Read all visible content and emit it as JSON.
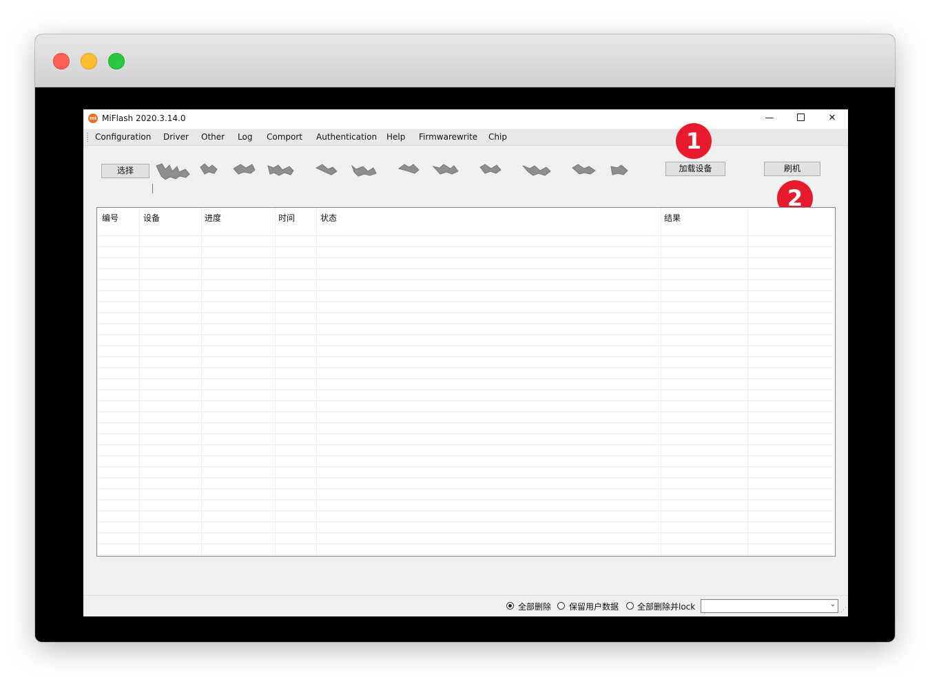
{
  "window": {
    "title": "MiFlash 2020.3.14.0",
    "app_icon_text": "mi",
    "minimize_glyph": "—",
    "close_glyph": "✕"
  },
  "menu": [
    "Configuration",
    "Driver",
    "Other",
    "Log",
    "Comport",
    "Authentication",
    "Help",
    "Firmwarewrite",
    "Chip"
  ],
  "toolbar": {
    "select_label": "选择",
    "load_devices_label": "加载设备",
    "flash_label": "刷机"
  },
  "annotations": {
    "step1": "1",
    "step2": "2"
  },
  "table": {
    "columns": [
      "编号",
      "设备",
      "进度",
      "时间",
      "状态",
      "结果",
      ""
    ],
    "rows": []
  },
  "bottom": {
    "options": [
      {
        "label": "全部删除",
        "selected": true
      },
      {
        "label": "保留用户数据",
        "selected": false
      },
      {
        "label": "全部删除并lock",
        "selected": false
      }
    ],
    "combo_value": "",
    "combo_arrow": "⌄"
  },
  "colors": {
    "badge": "#e81b2c",
    "app_icon": "#f36d21"
  }
}
